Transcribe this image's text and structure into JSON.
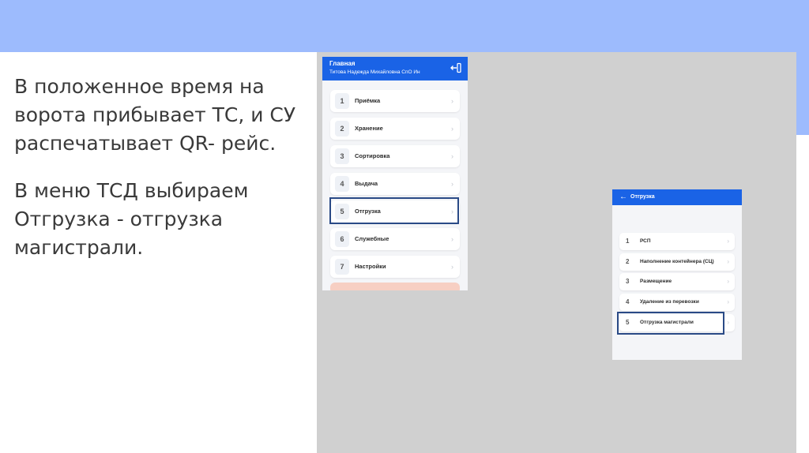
{
  "slide": {
    "paragraph1": "В положенное время на ворота прибывает ТС, и СУ распечатывает QR- рейс.",
    "paragraph2": "В меню ТСД выбираем Отгрузка - отгрузка магистрали."
  },
  "phone_main": {
    "title": "Главная",
    "user": "Титова Надежда Михайловна СпО Ин",
    "logout_icon": "logout-icon",
    "items": [
      {
        "num": "1",
        "label": "Приёмка"
      },
      {
        "num": "2",
        "label": "Хранение"
      },
      {
        "num": "3",
        "label": "Сортировка"
      },
      {
        "num": "4",
        "label": "Выдача"
      },
      {
        "num": "5",
        "label": "Отгрузка"
      },
      {
        "num": "6",
        "label": "Служебные"
      },
      {
        "num": "7",
        "label": "Настройки"
      }
    ]
  },
  "phone_shipping": {
    "title": "Отгрузка",
    "back_icon": "arrow-left-icon",
    "items": [
      {
        "num": "1",
        "label": "РСП"
      },
      {
        "num": "2",
        "label": "Наполнение контейнера (СЦ)"
      },
      {
        "num": "3",
        "label": "Размещение"
      },
      {
        "num": "4",
        "label": "Удаление из перевозки"
      },
      {
        "num": "5",
        "label": "Отгрузка магистрали"
      }
    ]
  },
  "colors": {
    "header_blue": "#1a63e6",
    "top_band": "#9dbbfd",
    "highlight": "#2a4a86"
  }
}
